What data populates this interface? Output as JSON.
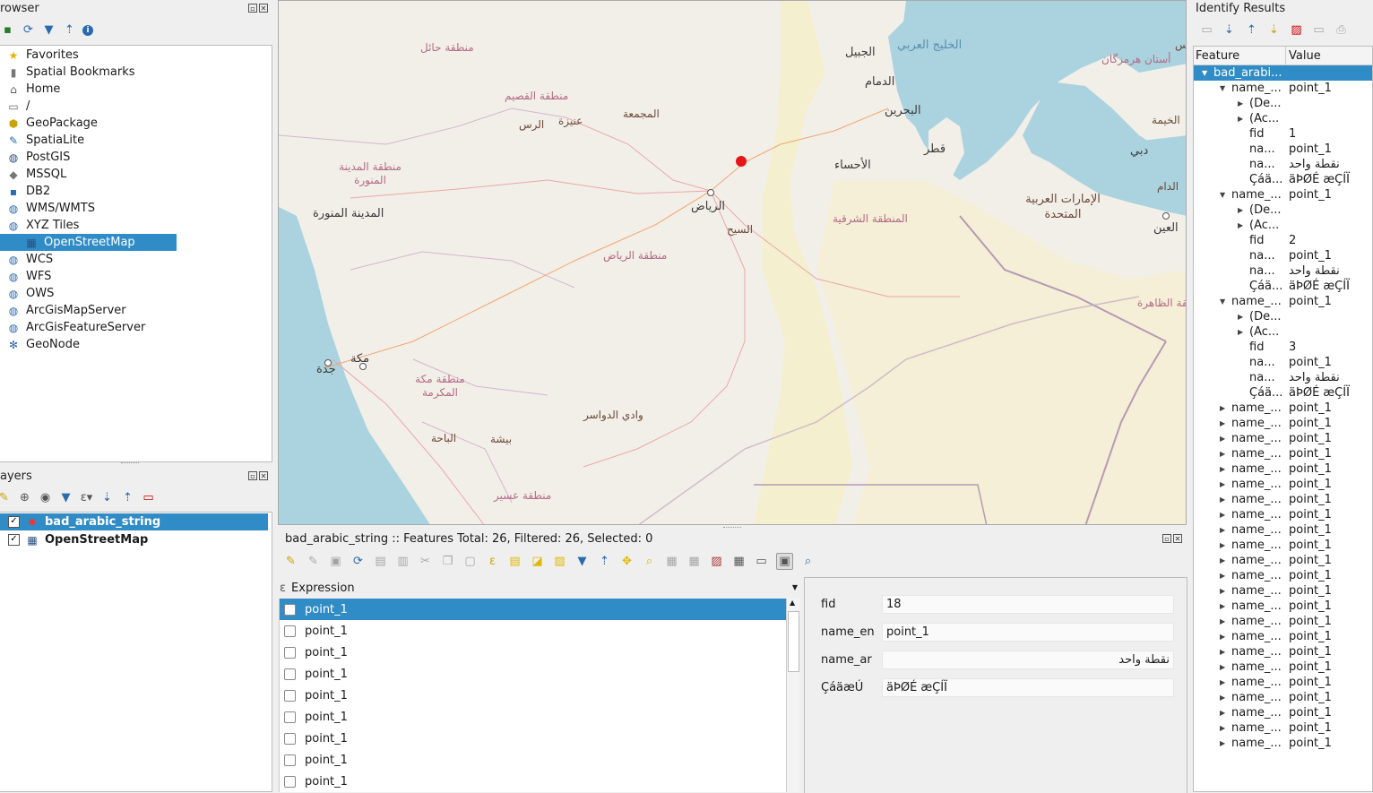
{
  "browser": {
    "title": "rowser",
    "items": [
      {
        "label": "Favorites",
        "icon": "star-icon"
      },
      {
        "label": "Spatial Bookmarks",
        "icon": "bookmark-icon"
      },
      {
        "label": "Home",
        "icon": "home-folder-icon"
      },
      {
        "label": "/",
        "icon": "folder-icon"
      },
      {
        "label": "GeoPackage",
        "icon": "geopackage-icon"
      },
      {
        "label": "SpatiaLite",
        "icon": "spatialite-icon"
      },
      {
        "label": "PostGIS",
        "icon": "postgis-icon"
      },
      {
        "label": "MSSQL",
        "icon": "mssql-icon"
      },
      {
        "label": "DB2",
        "icon": "db2-icon"
      },
      {
        "label": "WMS/WMTS",
        "icon": "globe-icon"
      },
      {
        "label": "XYZ Tiles",
        "icon": "globe-icon"
      },
      {
        "label": "OpenStreetMap",
        "icon": "tiles-icon",
        "child": true,
        "selected": true
      },
      {
        "label": "WCS",
        "icon": "globe-icon"
      },
      {
        "label": "WFS",
        "icon": "globe-icon"
      },
      {
        "label": "OWS",
        "icon": "globe-icon"
      },
      {
        "label": "ArcGisMapServer",
        "icon": "globe-icon"
      },
      {
        "label": "ArcGisFeatureServer",
        "icon": "globe-icon"
      },
      {
        "label": "GeoNode",
        "icon": "geonode-icon"
      }
    ]
  },
  "layers": {
    "title": "ayers",
    "items": [
      {
        "label": "bad_arabic_string",
        "selected": true
      },
      {
        "label": "OpenStreetMap",
        "selected": false
      }
    ]
  },
  "map": {
    "labels": {
      "hail": "منطقة حائل",
      "gulf": "الخليج العربي",
      "hormuz": "أستان هرمزگان",
      "jubail": "الجبيل",
      "dammam": "الدمام",
      "qassim": "منطقة القصيم",
      "majmaah": "المجمعة",
      "unaizah": "عنيزة",
      "rass": "الرس",
      "bahrain": "البحرين",
      "qatar": "قطر",
      "ahsa": "الأحساء",
      "madinah_region": "منطقة المدينة المنورة",
      "riyadh": "الرياض",
      "sulayyil": "السيح",
      "eastern": "المنطقة الشرقية",
      "uae": "الإمارات العربية المتحدة",
      "ain": "العين",
      "dubai": "دبي",
      "madinah": "المدينة المنورة",
      "riyadh_region": "منطقة الرياض",
      "dhahira": "منطقة الظاهرة",
      "jeddah": "جدة",
      "makkah": "مكة",
      "makkah_region": "منطقة مكة المكرمة",
      "dawasir": "وادي الدواسر",
      "baha": "الباحة",
      "bisha": "بيشة",
      "asir": "منطقة عسير",
      "khaimah": "الخيمة",
      "dhaid": "الدام",
      "sm": "س"
    }
  },
  "attribute_table": {
    "title": "bad_arabic_string :: Features Total: 26, Filtered: 26, Selected: 0",
    "expression_label": "Expression",
    "rows": [
      "point_1",
      "point_1",
      "point_1",
      "point_1",
      "point_1",
      "point_1",
      "point_1",
      "point_1",
      "point_1"
    ],
    "form": [
      {
        "label": "fid",
        "value": "18",
        "rtl": false
      },
      {
        "label": "name_en",
        "value": "point_1",
        "rtl": false
      },
      {
        "label": "name_ar",
        "value": "نقطة واحد",
        "rtl": true
      },
      {
        "label": "ÇáäæÚ",
        "value": "äÞØÉ æÇÍÏ",
        "rtl": false
      }
    ]
  },
  "identify": {
    "title": "Identify Results",
    "col_feature": "Feature",
    "col_value": "Value",
    "root": "bad_arabi...",
    "groups": [
      {
        "name": "name_...",
        "value": "point_1",
        "expanded": true,
        "fid": "1"
      },
      {
        "name": "name_...",
        "value": "point_1",
        "expanded": true,
        "fid": "2"
      },
      {
        "name": "name_...",
        "value": "point_1",
        "expanded": true,
        "fid": "3"
      }
    ],
    "sub_derived": "(De...",
    "sub_actions": "(Ac...",
    "fid_label": "fid",
    "attr_na": "na...",
    "attr_ca": "Çáä...",
    "val_en": "point_1",
    "val_ar": "نقطة واحد",
    "val_bad": "äÞØÉ æÇÍÏ",
    "collapsed_count": 23,
    "collapsed_name": "name_...",
    "collapsed_value": "point_1"
  }
}
